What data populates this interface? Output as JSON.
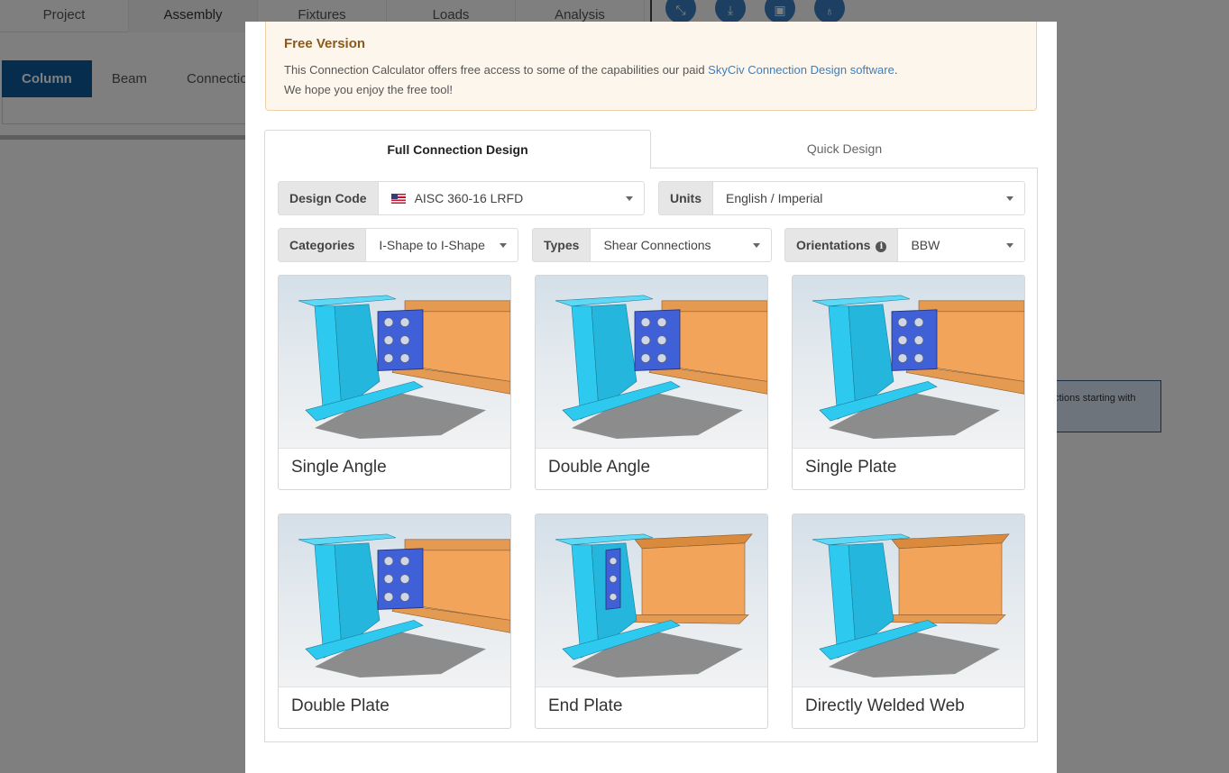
{
  "app": {
    "top_tabs": [
      "Project",
      "Assembly",
      "Fixtures",
      "Loads",
      "Analysis"
    ],
    "active_top_tab": "Assembly",
    "sub_tabs": [
      "Column",
      "Beam",
      "Connection"
    ],
    "active_sub_tab": "Column",
    "info_fragment": "ctions starting with",
    "tool_icons": [
      "compress-icon",
      "download-icon",
      "camera-icon",
      "lightbulb-icon"
    ]
  },
  "modal": {
    "free_title": "Free Version",
    "free_line1": "This Connection Calculator offers free access to some of the capabilities our paid ",
    "free_link": "SkyCiv Connection Design software",
    "free_line1_end": ".",
    "free_line2": "We hope you enjoy the free tool!",
    "tabs": [
      "Full Connection Design",
      "Quick Design"
    ],
    "active_tab": "Full Connection Design",
    "design_code": {
      "label": "Design Code",
      "value": "AISC 360-16 LRFD",
      "flag_icon": "us-flag-icon"
    },
    "units": {
      "label": "Units",
      "value": "English / Imperial"
    },
    "categories": {
      "label": "Categories",
      "value": "I-Shape to I-Shape"
    },
    "types": {
      "label": "Types",
      "value": "Shear Connections"
    },
    "orientations": {
      "label": "Orientations",
      "value": "BBW"
    },
    "cards": [
      {
        "title": "Single Angle",
        "bolts": 3,
        "cols": 2
      },
      {
        "title": "Double Angle",
        "bolts": 3,
        "cols": 2
      },
      {
        "title": "Single Plate",
        "bolts": 3,
        "cols": 2
      },
      {
        "title": "Double Plate",
        "bolts": 3,
        "cols": 2
      },
      {
        "title": "End Plate",
        "bolts": 3,
        "cols": 1
      },
      {
        "title": "Directly Welded Web",
        "bolts": 0,
        "cols": 0
      }
    ]
  },
  "colors": {
    "column": "#2ec9ef",
    "beam": "#f2a45a",
    "plate": "#4060d8",
    "accent": "#0d5a9a",
    "link": "#3a7fc2"
  }
}
